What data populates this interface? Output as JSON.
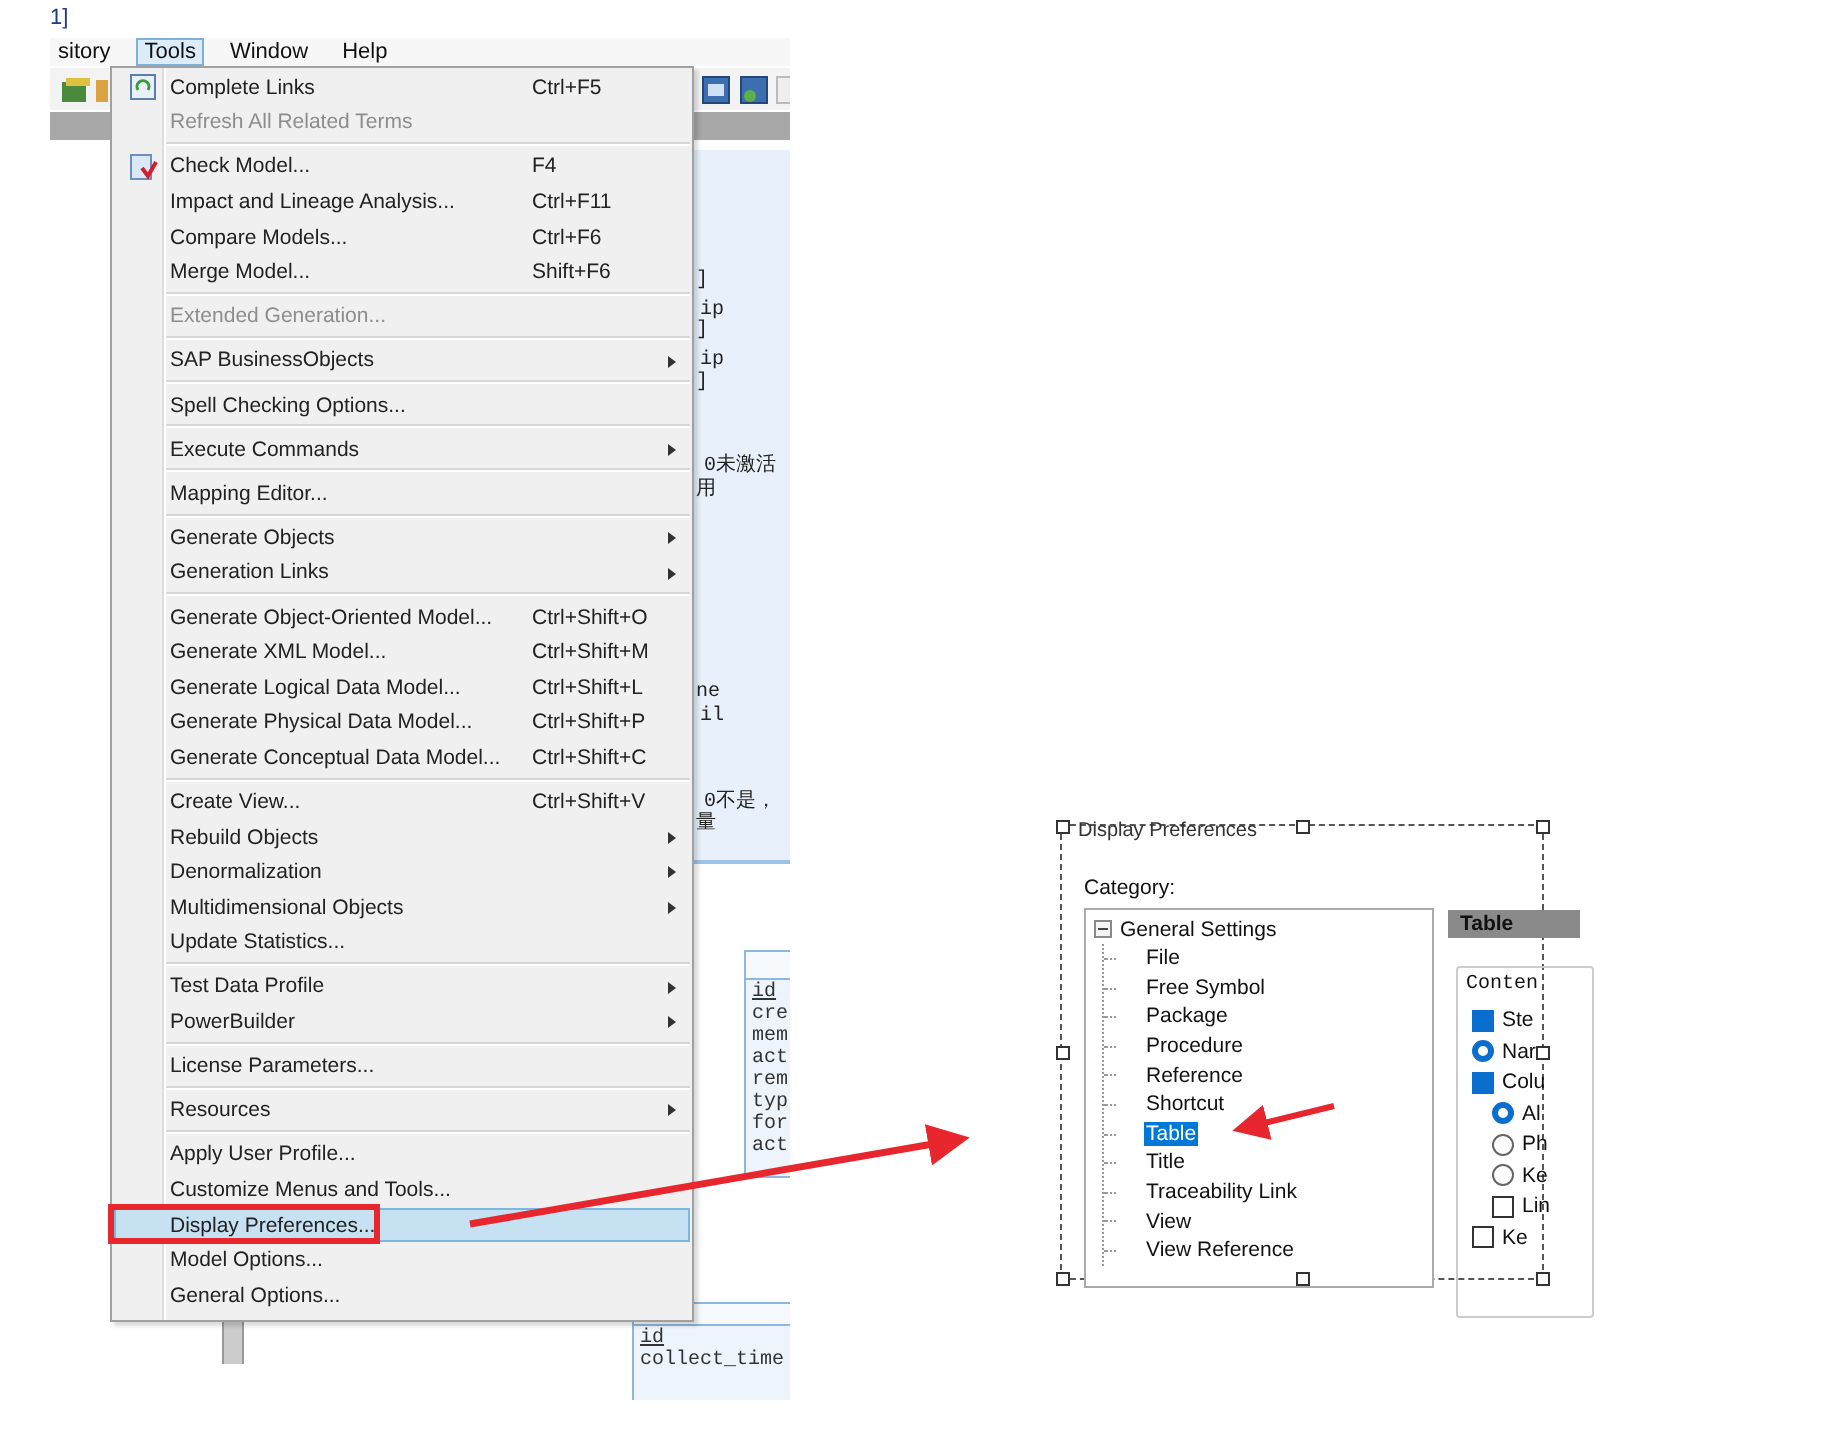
{
  "background_app": {
    "title_fragment": "1]",
    "menu_bar": [
      {
        "label": "sitory",
        "selected": false
      },
      {
        "label": "Tools",
        "selected": true
      },
      {
        "label": "Window",
        "selected": false
      },
      {
        "label": "Help",
        "selected": false
      }
    ],
    "diagram_text": [
      "]",
      "ip",
      "]",
      "ip",
      "]",
      "0未激活",
      "用",
      "ne",
      "il",
      "0不是，",
      "量"
    ],
    "table_1": [
      "id",
      "cre",
      "mem",
      "act",
      "rem",
      "typ",
      "for",
      "act"
    ],
    "table_2": [
      "id",
      "collect_time"
    ]
  },
  "tools_menu": {
    "groups": [
      [
        {
          "label": "Complete Links",
          "shortcut": "Ctrl+F5",
          "kind": "link",
          "submenu": false,
          "disabled": false,
          "selected": false
        },
        {
          "label": "Refresh All Related Terms",
          "kind": "plain",
          "submenu": false,
          "disabled": true,
          "selected": false
        }
      ],
      [
        {
          "label": "Check Model...",
          "shortcut": "F4",
          "kind": "check",
          "submenu": false,
          "disabled": false,
          "selected": false
        },
        {
          "label": "Impact and Lineage Analysis...",
          "shortcut": "Ctrl+F11",
          "kind": "plain",
          "submenu": false,
          "disabled": false,
          "selected": false
        },
        {
          "label": "Compare Models...",
          "shortcut": "Ctrl+F6",
          "kind": "plain",
          "submenu": false,
          "disabled": false,
          "selected": false
        },
        {
          "label": "Merge Model...",
          "shortcut": "Shift+F6",
          "kind": "plain",
          "submenu": false,
          "disabled": false,
          "selected": false
        }
      ],
      [
        {
          "label": "Extended Generation...",
          "kind": "plain",
          "submenu": false,
          "disabled": true,
          "selected": false
        }
      ],
      [
        {
          "label": "SAP BusinessObjects",
          "kind": "plain",
          "submenu": true,
          "disabled": false,
          "selected": false
        }
      ],
      [
        {
          "label": "Spell Checking Options...",
          "kind": "plain",
          "submenu": false,
          "disabled": false,
          "selected": false
        }
      ],
      [
        {
          "label": "Execute Commands",
          "kind": "plain",
          "submenu": true,
          "disabled": false,
          "selected": false
        }
      ],
      [
        {
          "label": "Mapping Editor...",
          "kind": "plain",
          "submenu": false,
          "disabled": false,
          "selected": false
        }
      ],
      [
        {
          "label": "Generate Objects",
          "kind": "plain",
          "submenu": true,
          "disabled": false,
          "selected": false
        },
        {
          "label": "Generation Links",
          "kind": "plain",
          "submenu": true,
          "disabled": false,
          "selected": false
        }
      ],
      [
        {
          "label": "Generate Object-Oriented Model...",
          "shortcut": "Ctrl+Shift+O",
          "kind": "plain",
          "submenu": false,
          "disabled": false,
          "selected": false
        },
        {
          "label": "Generate XML Model...",
          "shortcut": "Ctrl+Shift+M",
          "kind": "plain",
          "submenu": false,
          "disabled": false,
          "selected": false
        },
        {
          "label": "Generate Logical Data Model...",
          "shortcut": "Ctrl+Shift+L",
          "kind": "plain",
          "submenu": false,
          "disabled": false,
          "selected": false
        },
        {
          "label": "Generate Physical Data Model...",
          "shortcut": "Ctrl+Shift+P",
          "kind": "plain",
          "submenu": false,
          "disabled": false,
          "selected": false
        },
        {
          "label": "Generate Conceptual Data Model...",
          "shortcut": "Ctrl+Shift+C",
          "kind": "plain",
          "submenu": false,
          "disabled": false,
          "selected": false
        }
      ],
      [
        {
          "label": "Create View...",
          "shortcut": "Ctrl+Shift+V",
          "kind": "plain",
          "submenu": false,
          "disabled": false,
          "selected": false
        },
        {
          "label": "Rebuild Objects",
          "kind": "plain",
          "submenu": true,
          "disabled": false,
          "selected": false
        },
        {
          "label": "Denormalization",
          "kind": "plain",
          "submenu": true,
          "disabled": false,
          "selected": false
        },
        {
          "label": "Multidimensional Objects",
          "kind": "plain",
          "submenu": true,
          "disabled": false,
          "selected": false
        },
        {
          "label": "Update Statistics...",
          "kind": "plain",
          "submenu": false,
          "disabled": false,
          "selected": false
        }
      ],
      [
        {
          "label": "Test Data Profile",
          "kind": "plain",
          "submenu": true,
          "disabled": false,
          "selected": false
        },
        {
          "label": "PowerBuilder",
          "kind": "plain",
          "submenu": true,
          "disabled": false,
          "selected": false
        }
      ],
      [
        {
          "label": "License Parameters...",
          "kind": "plain",
          "submenu": false,
          "disabled": false,
          "selected": false
        }
      ],
      [
        {
          "label": "Resources",
          "kind": "plain",
          "submenu": true,
          "disabled": false,
          "selected": false
        }
      ],
      [
        {
          "label": "Apply User Profile...",
          "kind": "plain",
          "submenu": false,
          "disabled": false,
          "selected": false
        },
        {
          "label": "Customize Menus and Tools...",
          "kind": "plain",
          "submenu": false,
          "disabled": false,
          "selected": false
        },
        {
          "label": "Display Preferences...",
          "kind": "plain",
          "submenu": false,
          "disabled": false,
          "selected": true
        },
        {
          "label": "Model Options...",
          "kind": "plain",
          "submenu": false,
          "disabled": false,
          "selected": false
        },
        {
          "label": "General Options...",
          "kind": "plain",
          "submenu": false,
          "disabled": false,
          "selected": false
        }
      ]
    ]
  },
  "display_preferences": {
    "title": "Display Preferences",
    "category_label": "Category:",
    "tree": {
      "label": "General Settings",
      "expanded": true,
      "children": [
        {
          "label": "File",
          "selected": false
        },
        {
          "label": "Free Symbol",
          "selected": false
        },
        {
          "label": "Package",
          "selected": false
        },
        {
          "label": "Procedure",
          "selected": false
        },
        {
          "label": "Reference",
          "selected": false
        },
        {
          "label": "Shortcut",
          "selected": false
        },
        {
          "label": "Table",
          "selected": true
        },
        {
          "label": "Title",
          "selected": false
        },
        {
          "label": "Traceability Link",
          "selected": false
        },
        {
          "label": "View",
          "selected": false
        },
        {
          "label": "View Reference",
          "selected": false
        }
      ]
    },
    "panel_title": "Table",
    "group_label": "Conten",
    "options": [
      {
        "kind": "checkbox",
        "label": "Ste",
        "checked": true
      },
      {
        "kind": "radio",
        "label": "Nar",
        "checked": true
      },
      {
        "kind": "checkbox",
        "label": "Colu",
        "checked": true,
        "children": [
          {
            "kind": "radio",
            "label": "Al",
            "checked": true
          },
          {
            "kind": "radio",
            "label": "Ph",
            "checked": false
          },
          {
            "kind": "radio",
            "label": "Ke",
            "checked": false
          },
          {
            "kind": "checkbox",
            "label": "Lin",
            "checked": false
          }
        ]
      },
      {
        "kind": "checkbox",
        "label": "Ke",
        "checked": false
      }
    ]
  }
}
